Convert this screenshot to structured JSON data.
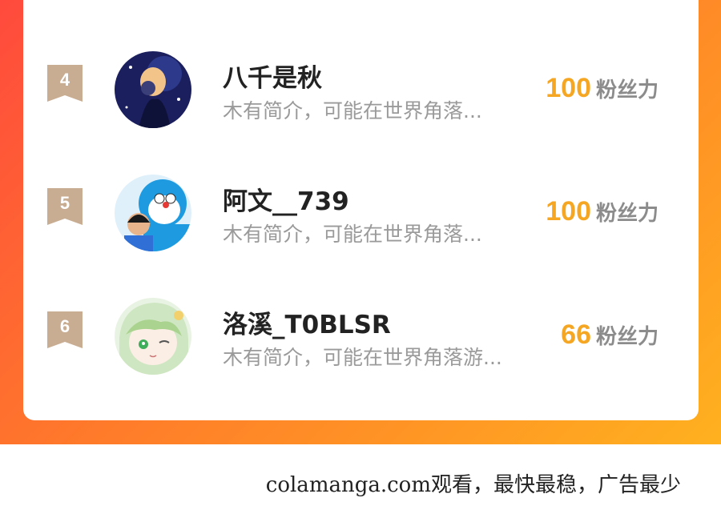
{
  "ranking": {
    "entries": [
      {
        "rank": "4",
        "name": "八千是秋",
        "bio": "木有简介，可能在世界角落...",
        "fans_count": "100",
        "fans_unit": "粉丝力",
        "avatar": "avatar-night-couple"
      },
      {
        "rank": "5",
        "name": "阿文__739",
        "bio": "木有简介，可能在世界角落...",
        "fans_count": "100",
        "fans_unit": "粉丝力",
        "avatar": "avatar-doraemon-child"
      },
      {
        "rank": "6",
        "name": "洛溪_T0BLSR",
        "bio": "木有简介，可能在世界角落游...",
        "fans_count": "66",
        "fans_unit": "粉丝力",
        "avatar": "avatar-anime-girl"
      }
    ]
  },
  "footer": {
    "watermark": "colamanga.com观看，最快最稳，广告最少"
  },
  "colors": {
    "accent_gradient_start": "#ff4a3d",
    "accent_gradient_end": "#ffb11f",
    "fans_count": "#f5a623",
    "rank_badge": "#c8ad92"
  }
}
